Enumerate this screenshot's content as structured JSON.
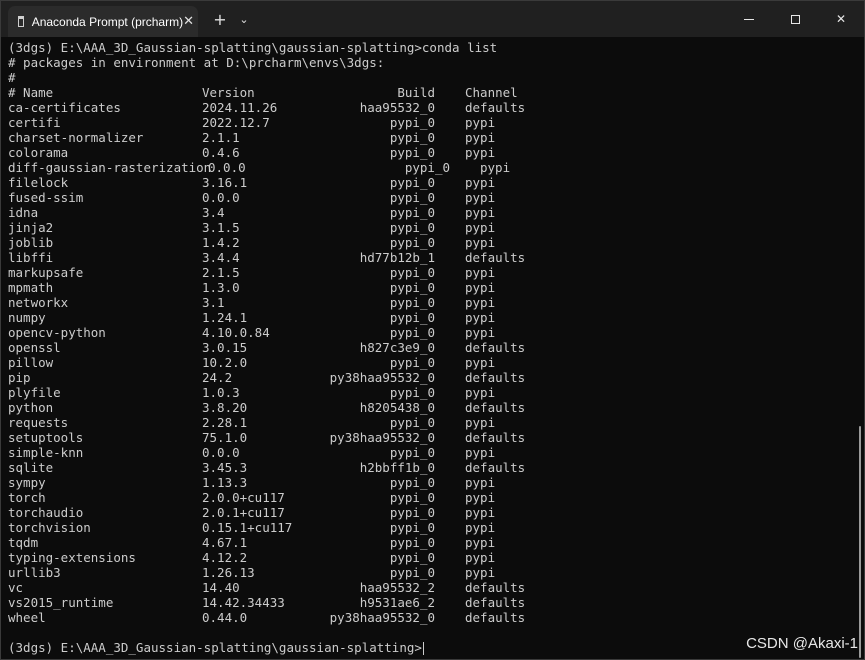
{
  "window": {
    "tab_title": "Anaconda Prompt (prcharm)",
    "tab_close": "✕",
    "new_tab": "+",
    "dropdown": "⌄",
    "close_glyph": "✕"
  },
  "terminal": {
    "command_line": "(3dgs) E:\\AAA_3D_Gaussian-splatting\\gaussian-splatting>conda list",
    "env_line": "# packages in environment at D:\\prcharm\\envs\\3dgs:",
    "hash_line": "#",
    "headers": {
      "name": "# Name",
      "version": "Version",
      "build": "Build",
      "channel": "Channel"
    },
    "packages": [
      {
        "name": "ca-certificates",
        "version": "2024.11.26",
        "build": "haa95532_0",
        "channel": "defaults"
      },
      {
        "name": "certifi",
        "version": "2022.12.7",
        "build": "pypi_0",
        "channel": "pypi"
      },
      {
        "name": "charset-normalizer",
        "version": "2.1.1",
        "build": "pypi_0",
        "channel": "pypi"
      },
      {
        "name": "colorama",
        "version": "0.4.6",
        "build": "pypi_0",
        "channel": "pypi"
      },
      {
        "name": "diff-gaussian-rasterization",
        "version": "0.0.0",
        "build": "pypi_0",
        "channel": "pypi"
      },
      {
        "name": "filelock",
        "version": "3.16.1",
        "build": "pypi_0",
        "channel": "pypi"
      },
      {
        "name": "fused-ssim",
        "version": "0.0.0",
        "build": "pypi_0",
        "channel": "pypi"
      },
      {
        "name": "idna",
        "version": "3.4",
        "build": "pypi_0",
        "channel": "pypi"
      },
      {
        "name": "jinja2",
        "version": "3.1.5",
        "build": "pypi_0",
        "channel": "pypi"
      },
      {
        "name": "joblib",
        "version": "1.4.2",
        "build": "pypi_0",
        "channel": "pypi"
      },
      {
        "name": "libffi",
        "version": "3.4.4",
        "build": "hd77b12b_1",
        "channel": "defaults"
      },
      {
        "name": "markupsafe",
        "version": "2.1.5",
        "build": "pypi_0",
        "channel": "pypi"
      },
      {
        "name": "mpmath",
        "version": "1.3.0",
        "build": "pypi_0",
        "channel": "pypi"
      },
      {
        "name": "networkx",
        "version": "3.1",
        "build": "pypi_0",
        "channel": "pypi"
      },
      {
        "name": "numpy",
        "version": "1.24.1",
        "build": "pypi_0",
        "channel": "pypi"
      },
      {
        "name": "opencv-python",
        "version": "4.10.0.84",
        "build": "pypi_0",
        "channel": "pypi"
      },
      {
        "name": "openssl",
        "version": "3.0.15",
        "build": "h827c3e9_0",
        "channel": "defaults"
      },
      {
        "name": "pillow",
        "version": "10.2.0",
        "build": "pypi_0",
        "channel": "pypi"
      },
      {
        "name": "pip",
        "version": "24.2",
        "build": "py38haa95532_0",
        "channel": "defaults"
      },
      {
        "name": "plyfile",
        "version": "1.0.3",
        "build": "pypi_0",
        "channel": "pypi"
      },
      {
        "name": "python",
        "version": "3.8.20",
        "build": "h8205438_0",
        "channel": "defaults"
      },
      {
        "name": "requests",
        "version": "2.28.1",
        "build": "pypi_0",
        "channel": "pypi"
      },
      {
        "name": "setuptools",
        "version": "75.1.0",
        "build": "py38haa95532_0",
        "channel": "defaults"
      },
      {
        "name": "simple-knn",
        "version": "0.0.0",
        "build": "pypi_0",
        "channel": "pypi"
      },
      {
        "name": "sqlite",
        "version": "3.45.3",
        "build": "h2bbff1b_0",
        "channel": "defaults"
      },
      {
        "name": "sympy",
        "version": "1.13.3",
        "build": "pypi_0",
        "channel": "pypi"
      },
      {
        "name": "torch",
        "version": "2.0.0+cu117",
        "build": "pypi_0",
        "channel": "pypi"
      },
      {
        "name": "torchaudio",
        "version": "2.0.1+cu117",
        "build": "pypi_0",
        "channel": "pypi"
      },
      {
        "name": "torchvision",
        "version": "0.15.1+cu117",
        "build": "pypi_0",
        "channel": "pypi"
      },
      {
        "name": "tqdm",
        "version": "4.67.1",
        "build": "pypi_0",
        "channel": "pypi"
      },
      {
        "name": "typing-extensions",
        "version": "4.12.2",
        "build": "pypi_0",
        "channel": "pypi"
      },
      {
        "name": "urllib3",
        "version": "1.26.13",
        "build": "pypi_0",
        "channel": "pypi"
      },
      {
        "name": "vc",
        "version": "14.40",
        "build": "haa95532_2",
        "channel": "defaults"
      },
      {
        "name": "vs2015_runtime",
        "version": "14.42.34433",
        "build": "h9531ae6_2",
        "channel": "defaults"
      },
      {
        "name": "wheel",
        "version": "0.44.0",
        "build": "py38haa95532_0",
        "channel": "defaults"
      }
    ],
    "prompt": "(3dgs) E:\\AAA_3D_Gaussian-splatting\\gaussian-splatting>"
  },
  "watermark": "CSDN @Akaxi-1"
}
